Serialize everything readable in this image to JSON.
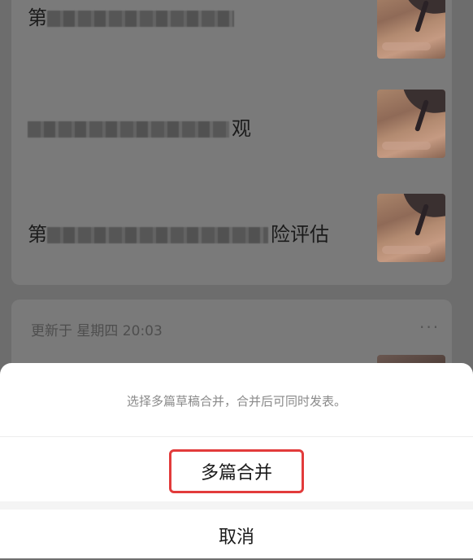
{
  "drafts": [
    {
      "title_prefix": "第",
      "title_suffix": "",
      "blur_segments": 5
    },
    {
      "title_prefix": "",
      "title_suffix": "观",
      "blur_segments": 7
    },
    {
      "title_prefix": "第",
      "title_suffix": "险评估",
      "blur_segments": 8
    }
  ],
  "second_draft": {
    "updated_label": "更新于 星期四 20:03",
    "more": "···"
  },
  "sheet": {
    "hint": "选择多篇草稿合并，合并后可同时发表。",
    "merge_label": "多篇合并",
    "cancel_label": "取消"
  },
  "colors": {
    "highlight_border": "#e23b3b"
  }
}
